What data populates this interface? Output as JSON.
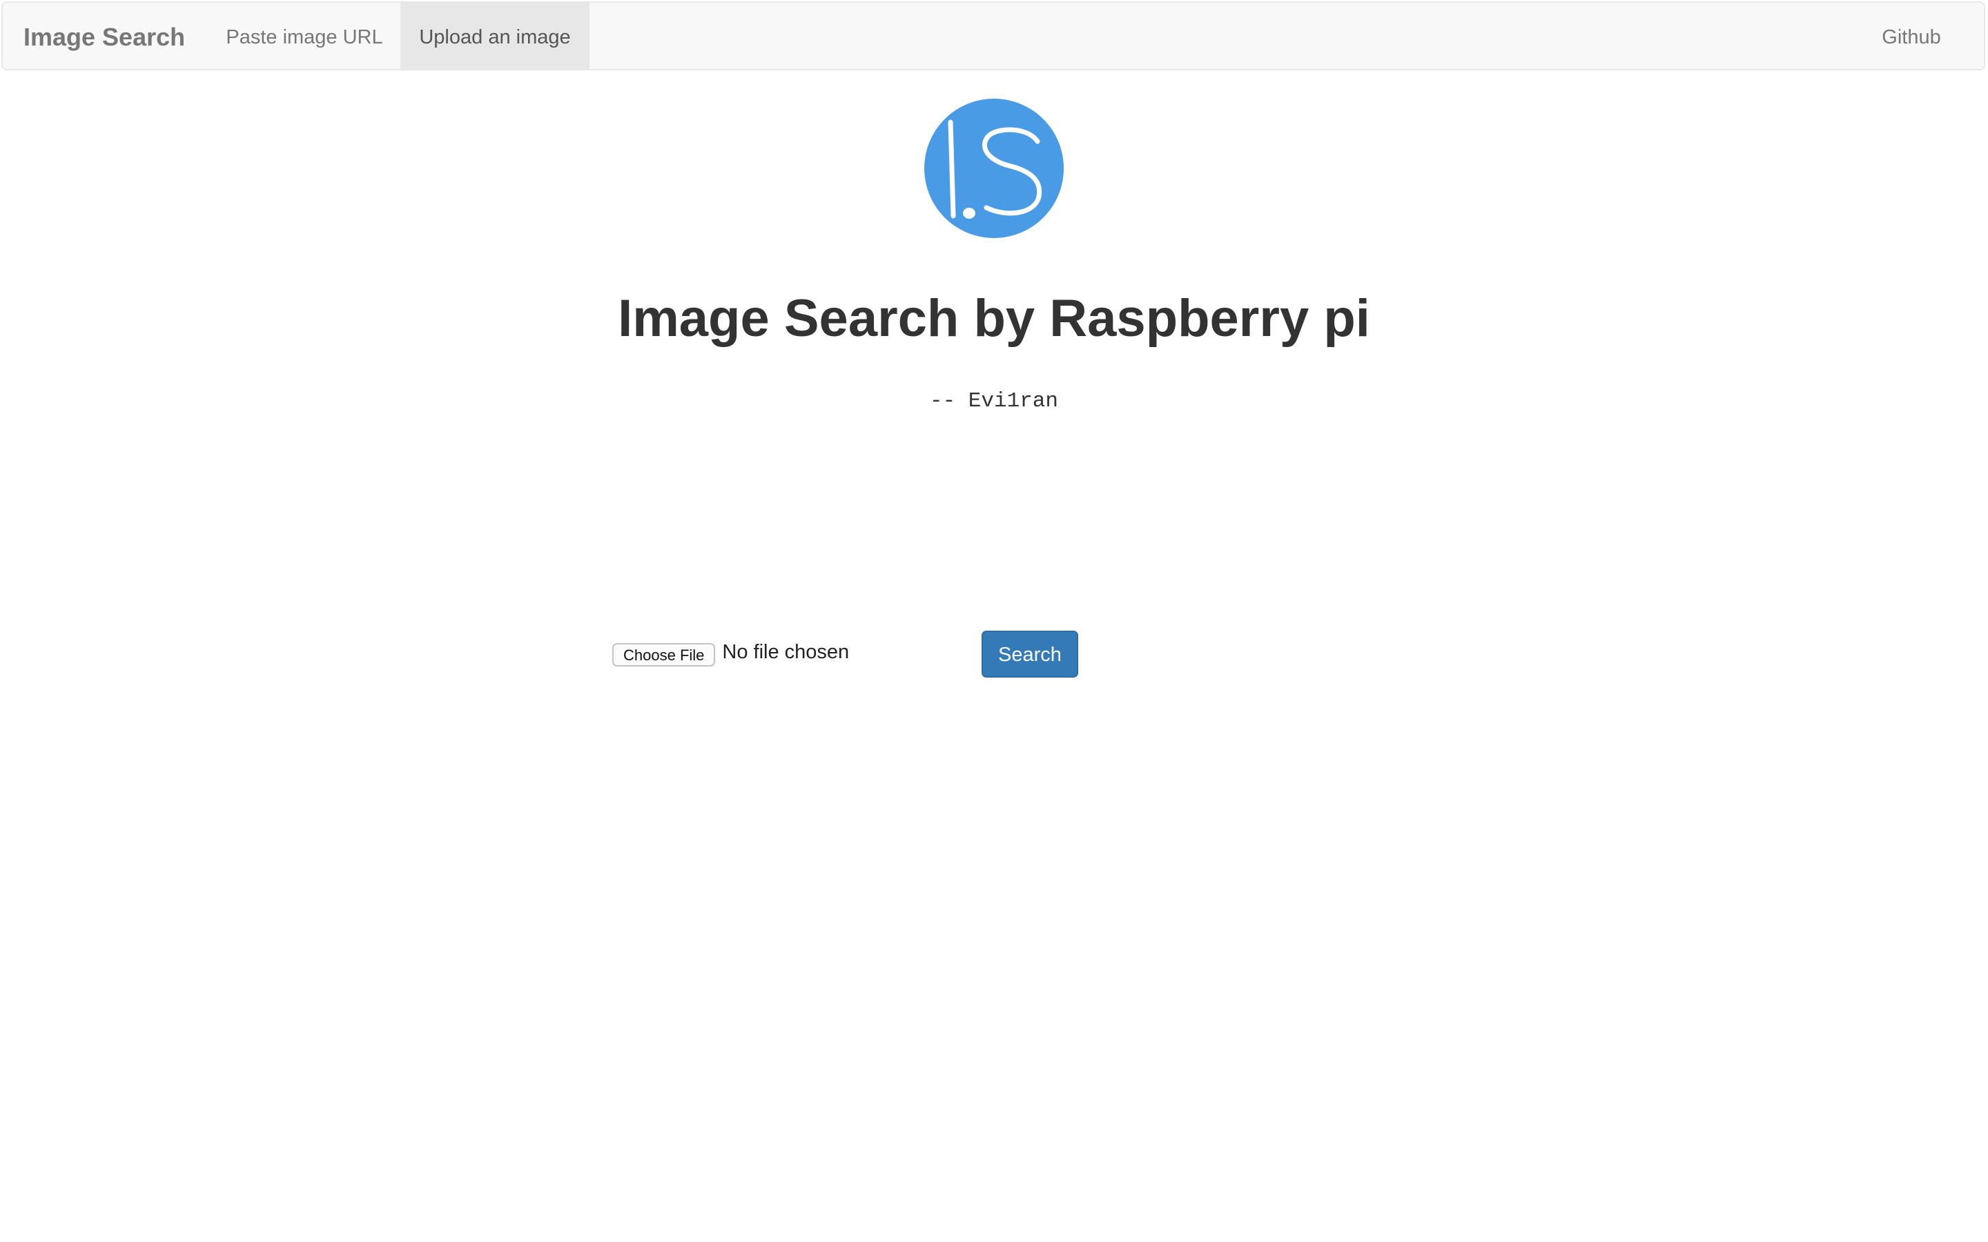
{
  "navbar": {
    "brand": "Image Search",
    "items": [
      {
        "label": "Paste image URL",
        "active": false
      },
      {
        "label": "Upload an image",
        "active": true
      }
    ],
    "right_link": "Github"
  },
  "main": {
    "logo_icon": "image-search-logo-icon",
    "logo_color": "#4a9be5",
    "title": "Image Search by Raspberry pi",
    "author": "-- Evi1ran"
  },
  "upload": {
    "choose_file_label": "Choose File",
    "file_status": "No file chosen",
    "search_label": "Search",
    "search_color": "#337ab7"
  }
}
